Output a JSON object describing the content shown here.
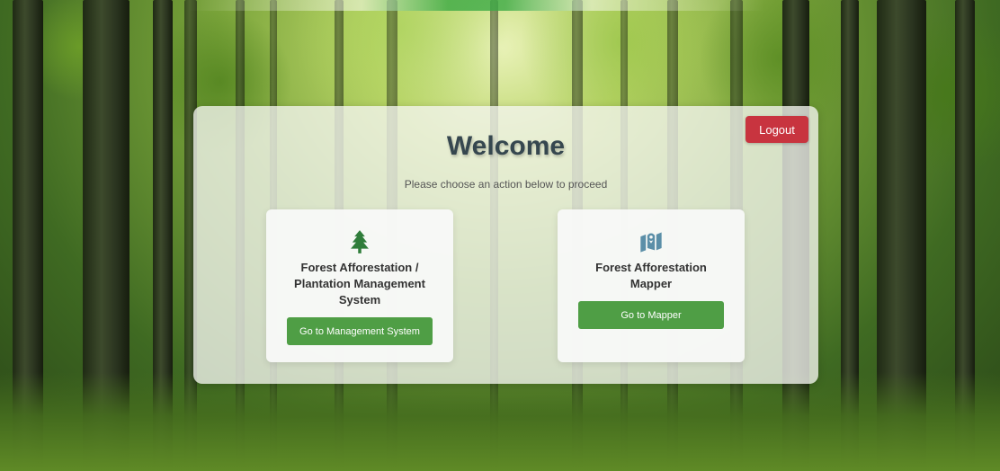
{
  "panel": {
    "title": "Welcome",
    "subtitle": "Please choose an action below to proceed",
    "logout_label": "Logout"
  },
  "cards": [
    {
      "icon": "tree-icon",
      "title": "Forest Afforestation /\nPlantation Management\nSystem",
      "button_label": "Go to Management System"
    },
    {
      "icon": "map-icon",
      "title": "Forest Afforestation\nMapper",
      "button_label": "Go to Mapper"
    }
  ],
  "colors": {
    "accent_green": "#4f9e45",
    "logout_red": "#c8343f",
    "icon_green": "#2f7d3a",
    "icon_teal": "#5b8fa8",
    "title_text": "#36474f"
  }
}
